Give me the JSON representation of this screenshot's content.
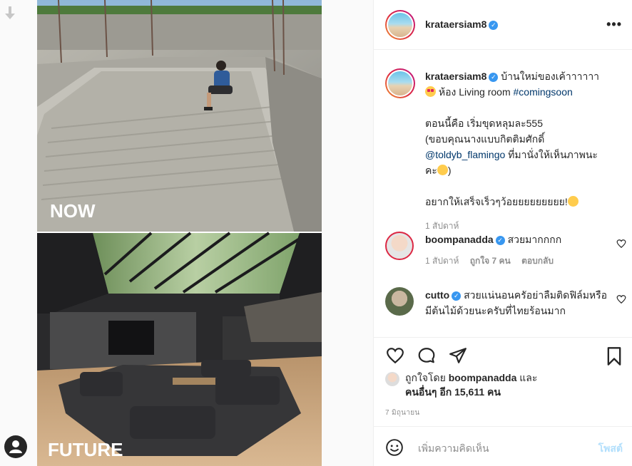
{
  "media": {
    "top_label": "NOW",
    "bottom_label": "FUTURE"
  },
  "header": {
    "username": "krataersiam8",
    "more_icon": "more-horizontal-icon"
  },
  "caption": {
    "username": "krataersiam8",
    "line1": "บ้านใหม่ของเค้าาาาาา",
    "line2_text": "ห้อง Living room ",
    "hashtag": "#comingsoon",
    "para1": "ตอนนี้คือ เริ่มขุดหลุมละ555",
    "para2": "(ขอบคุณนางแบบกิตติมศักดิ์",
    "mention": "@toldyb_flamingo",
    "para3": " ที่มานั่งให้เห็นภาพนะ",
    "para4": "คะ",
    "para4_end": ")",
    "para5": "อยากให้เสร็จเร็วๆว้อยยยยยยยยย!",
    "time": "1 สัปดาห์"
  },
  "comments": [
    {
      "username": "boompanadda",
      "text": "สวยมากกกก",
      "time": "1 สัปดาห์",
      "likes": "ถูกใจ 7 คน",
      "reply": "ตอบกลับ"
    },
    {
      "username": "cutto",
      "text": "สวยแน่นอนครัอย่าลืมติดฟิล์มหรือมีต้นไม้ด้วยนะครับที่ไทยร้อนมาก"
    }
  ],
  "likes": {
    "prefix": "ถูกใจโดย ",
    "liker": "boompanadda",
    "and": " และ",
    "others": "คนอื่นๆ อีก 15,611 คน"
  },
  "date": "7 มิถุนายน",
  "add_comment": {
    "placeholder": "เพิ่มความคิดเห็น",
    "post_label": "โพสต์"
  },
  "colors": {
    "verified": "#3897f0",
    "link": "#00376b",
    "muted": "#8e8e8e"
  }
}
